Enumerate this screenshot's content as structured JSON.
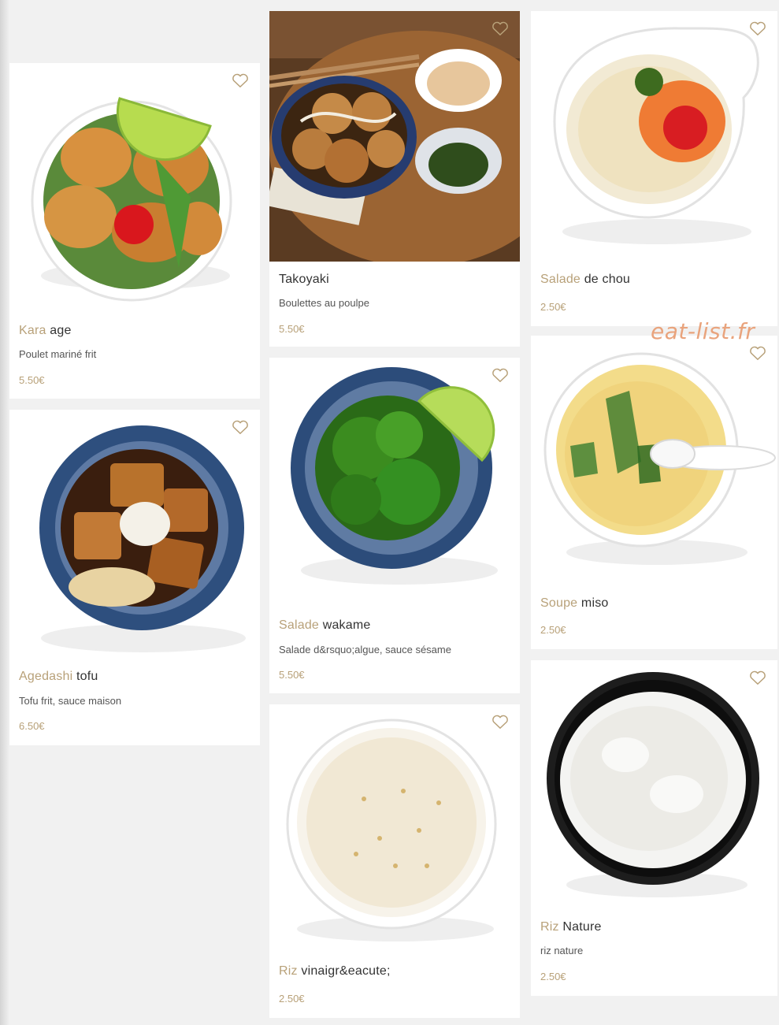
{
  "watermark": "eat-list.fr",
  "colors": {
    "accent": "#b8a179",
    "watermark": "#e9a37c",
    "background": "#f1f1f1",
    "card": "#ffffff"
  },
  "items": [
    {
      "accent": "Kara",
      "name": "age",
      "description": "Poulet mariné frit",
      "price": "5.50€",
      "photo": "karaage-bowl"
    },
    {
      "accent": "Agedashi",
      "name": "tofu",
      "description": "Tofu frit, sauce maison",
      "price": "6.50€",
      "photo": "agedashi-tofu-bowl"
    },
    {
      "accent": "",
      "name": "Takoyaki",
      "description": "Boulettes au poulpe",
      "price": "5.50€",
      "photo": "takoyaki-board"
    },
    {
      "accent": "Salade",
      "name": "wakame",
      "description": "Salade d&rsquo;algue, sauce sésame",
      "price": "5.50€",
      "photo": "wakame-bowl"
    },
    {
      "accent": "Riz",
      "name": "vinaigr&eacute;",
      "description": "",
      "price": "2.50€",
      "photo": "vinegar-rice-bowl"
    },
    {
      "accent": "Salade",
      "name": "de chou",
      "description": "",
      "price": "2.50€",
      "photo": "cabbage-salad-bowl"
    },
    {
      "accent": "Soupe",
      "name": "miso",
      "description": "",
      "price": "2.50€",
      "photo": "miso-soup-bowl"
    },
    {
      "accent": "Riz",
      "name": "Nature",
      "description": "riz nature",
      "price": "2.50€",
      "photo": "white-rice-bowl"
    }
  ]
}
